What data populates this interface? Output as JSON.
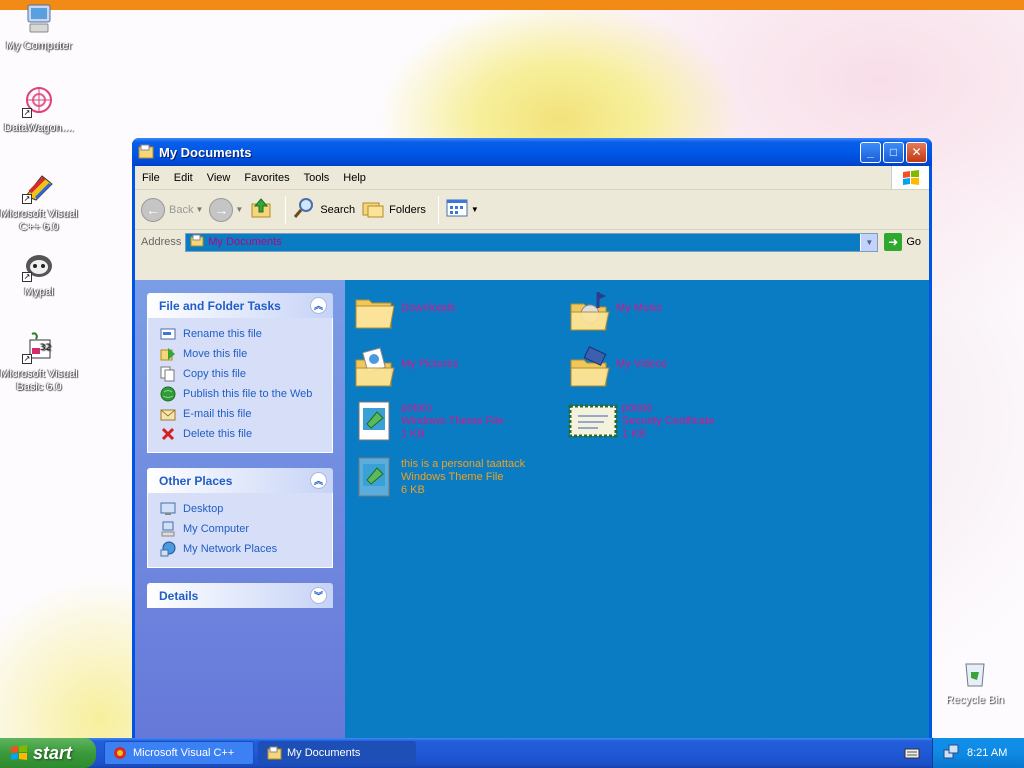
{
  "desktop": {
    "icons": [
      {
        "label": "My Computer"
      },
      {
        "label": "DataWagon...."
      },
      {
        "label": "Microsoft Visual C++ 6.0"
      },
      {
        "label": "Mypal"
      },
      {
        "label": "Microsoft Visual Basic 6.0"
      }
    ],
    "recycle_bin": "Recycle Bin"
  },
  "window": {
    "title": "My Documents",
    "menu": [
      "File",
      "Edit",
      "View",
      "Favorites",
      "Tools",
      "Help"
    ],
    "toolbar": {
      "back": "Back",
      "search": "Search",
      "folders": "Folders"
    },
    "address": {
      "label": "Address",
      "value": "My Documents",
      "go": "Go"
    },
    "tasks_panel": {
      "title": "File and Folder Tasks",
      "items": [
        "Rename this file",
        "Move this file",
        "Copy this file",
        "Publish this file to the Web",
        "E-mail this file",
        "Delete this file"
      ]
    },
    "places_panel": {
      "title": "Other Places",
      "items": [
        "Desktop",
        "My Computer",
        "My Network Places"
      ]
    },
    "details_panel": {
      "title": "Details"
    },
    "files": [
      {
        "line1": "Downloads",
        "line2": "",
        "line3": ""
      },
      {
        "line1": "My Music",
        "line2": "",
        "line3": ""
      },
      {
        "line1": "My Pictures",
        "line2": "",
        "line3": ""
      },
      {
        "line1": "My Videos",
        "line2": "",
        "line3": ""
      },
      {
        "line1": "potato",
        "line2": "Windows Theme File",
        "line3": "1 KB"
      },
      {
        "line1": "potato",
        "line2": "Security Certificate",
        "line3": "1 KB"
      },
      {
        "line1": "this is a personal taattack",
        "line2": "Windows Theme File",
        "line3": "6 KB"
      }
    ]
  },
  "taskbar": {
    "start": "start",
    "buttons": [
      "Microsoft Visual C++",
      "My Documents"
    ],
    "clock": "8:21 AM"
  },
  "colors": {
    "folder_view_bg": "#0a7cc4",
    "file_name_text": "#d4178a",
    "selected_file_text": "#f0a020",
    "task_link": "#215dc6",
    "topbar": "#f28a16"
  }
}
